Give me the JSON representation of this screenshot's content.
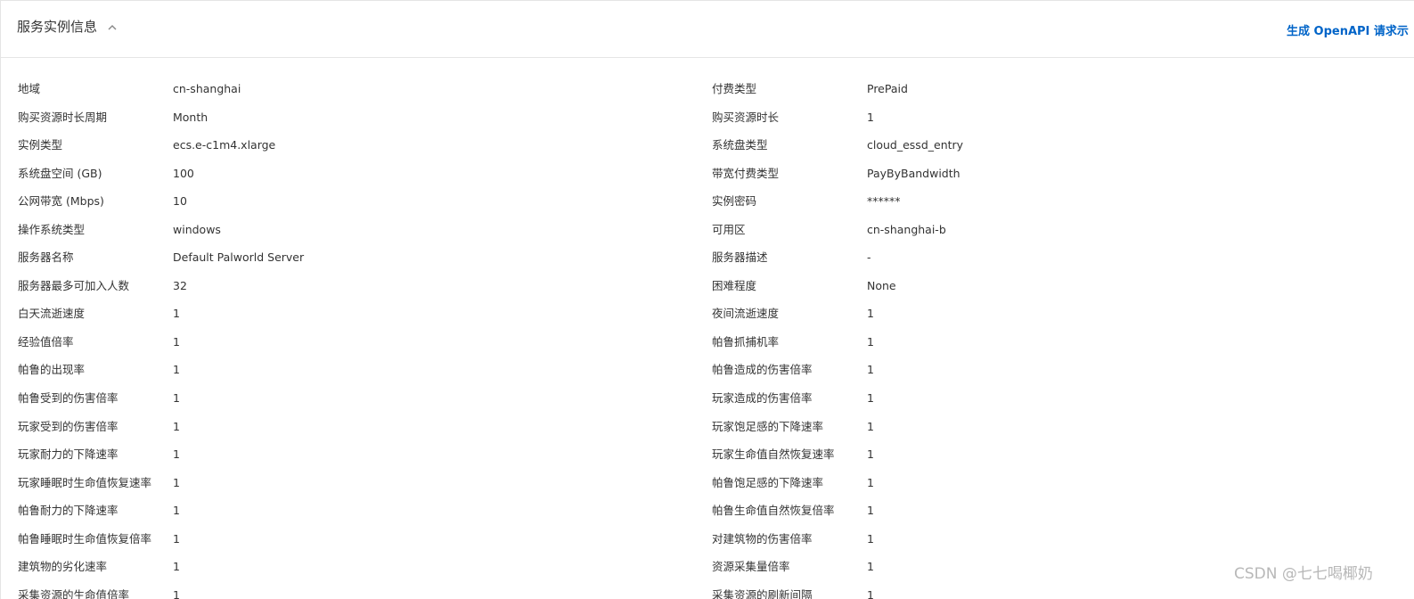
{
  "header": {
    "title": "服务实例信息",
    "openapi_link": "生成 OpenAPI 请求示"
  },
  "rows": [
    {
      "l1": "地域",
      "v1": "cn-shanghai",
      "l2": "付费类型",
      "v2": "PrePaid"
    },
    {
      "l1": "购买资源时长周期",
      "v1": "Month",
      "l2": "购买资源时长",
      "v2": "1"
    },
    {
      "l1": "实例类型",
      "v1": "ecs.e-c1m4.xlarge",
      "l2": "系统盘类型",
      "v2": "cloud_essd_entry"
    },
    {
      "l1": "系统盘空间 (GB)",
      "v1": "100",
      "l2": "带宽付费类型",
      "v2": "PayByBandwidth"
    },
    {
      "l1": "公网带宽 (Mbps)",
      "v1": "10",
      "l2": "实例密码",
      "v2": "******"
    },
    {
      "l1": "操作系统类型",
      "v1": "windows",
      "l2": "可用区",
      "v2": "cn-shanghai-b"
    },
    {
      "l1": "服务器名称",
      "v1": "Default Palworld Server",
      "l2": "服务器描述",
      "v2": "-"
    },
    {
      "l1": "服务器最多可加入人数",
      "v1": "32",
      "l2": "困难程度",
      "v2": "None"
    },
    {
      "l1": "白天流逝速度",
      "v1": "1",
      "l2": "夜间流逝速度",
      "v2": "1"
    },
    {
      "l1": "经验值倍率",
      "v1": "1",
      "l2": "帕鲁抓捕机率",
      "v2": "1"
    },
    {
      "l1": "帕鲁的出现率",
      "v1": "1",
      "l2": "帕鲁造成的伤害倍率",
      "v2": "1"
    },
    {
      "l1": "帕鲁受到的伤害倍率",
      "v1": "1",
      "l2": "玩家造成的伤害倍率",
      "v2": "1"
    },
    {
      "l1": "玩家受到的伤害倍率",
      "v1": "1",
      "l2": "玩家饱足感的下降速率",
      "v2": "1"
    },
    {
      "l1": "玩家耐力的下降速率",
      "v1": "1",
      "l2": "玩家生命值自然恢复速率",
      "v2": "1"
    },
    {
      "l1": "玩家睡眠时生命值恢复速率",
      "v1": "1",
      "l2": "帕鲁饱足感的下降速率",
      "v2": "1"
    },
    {
      "l1": "帕鲁耐力的下降速率",
      "v1": "1",
      "l2": "帕鲁生命值自然恢复倍率",
      "v2": "1"
    },
    {
      "l1": "帕鲁睡眠时生命值恢复倍率",
      "v1": "1",
      "l2": "对建筑物的伤害倍率",
      "v2": "1"
    },
    {
      "l1": "建筑物的劣化速率",
      "v1": "1",
      "l2": "资源采集量倍率",
      "v2": "1"
    },
    {
      "l1": "采集资源的生命值倍率",
      "v1": "1",
      "l2": "采集资源的刷新间隔",
      "v2": "1"
    }
  ],
  "watermark": "CSDN @七七喝椰奶"
}
